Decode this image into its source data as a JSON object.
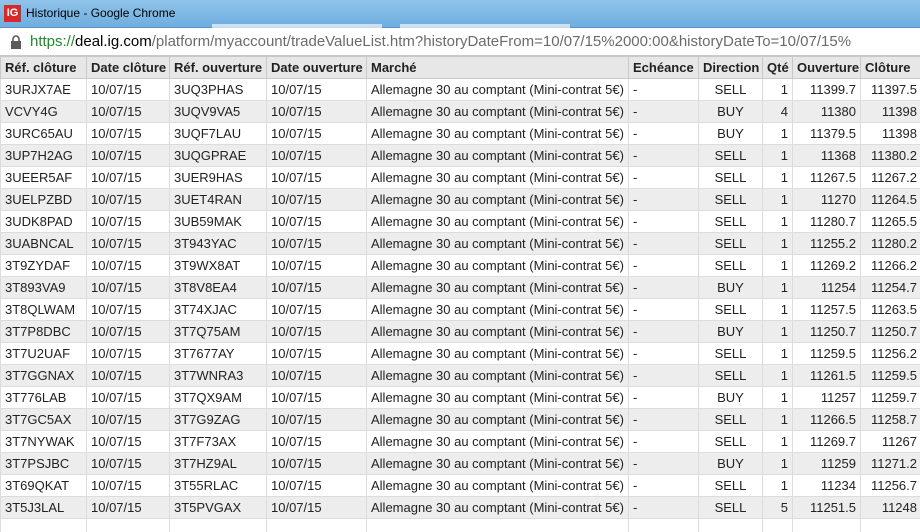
{
  "window": {
    "logo_text": "IG",
    "title": "Historique - Google Chrome"
  },
  "address": {
    "scheme": "https://",
    "host": "deal.ig.com",
    "path": "/platform/myaccount/tradeValueList.htm?historyDateFrom=10/07/15%2000:00&historyDateTo=10/07/15%"
  },
  "table": {
    "headers": [
      "Réf. clôture",
      "Date clôture",
      "Réf. ouverture",
      "Date ouverture",
      "Marché",
      "Echéance",
      "Direction",
      "Qté",
      "Ouverture",
      "Clôture"
    ],
    "rows": [
      [
        "3URJX7AE",
        "10/07/15",
        "3UQ3PHAS",
        "10/07/15",
        "Allemagne 30 au comptant (Mini-contrat 5€)",
        "-",
        "SELL",
        "1",
        "11399.7",
        "11397.5"
      ],
      [
        "VCVY4G",
        "10/07/15",
        "3UQV9VA5",
        "10/07/15",
        "Allemagne 30 au comptant (Mini-contrat 5€)",
        "-",
        "BUY",
        "4",
        "11380",
        "11398"
      ],
      [
        "3URC65AU",
        "10/07/15",
        "3UQF7LAU",
        "10/07/15",
        "Allemagne 30 au comptant (Mini-contrat 5€)",
        "-",
        "BUY",
        "1",
        "11379.5",
        "11398"
      ],
      [
        "3UP7H2AG",
        "10/07/15",
        "3UQGPRAE",
        "10/07/15",
        "Allemagne 30 au comptant (Mini-contrat 5€)",
        "-",
        "SELL",
        "1",
        "11368",
        "11380.2"
      ],
      [
        "3UEER5AF",
        "10/07/15",
        "3UER9HAS",
        "10/07/15",
        "Allemagne 30 au comptant (Mini-contrat 5€)",
        "-",
        "SELL",
        "1",
        "11267.5",
        "11267.2"
      ],
      [
        "3UELPZBD",
        "10/07/15",
        "3UET4RAN",
        "10/07/15",
        "Allemagne 30 au comptant (Mini-contrat 5€)",
        "-",
        "SELL",
        "1",
        "11270",
        "11264.5"
      ],
      [
        "3UDK8PAD",
        "10/07/15",
        "3UB59MAK",
        "10/07/15",
        "Allemagne 30 au comptant (Mini-contrat 5€)",
        "-",
        "SELL",
        "1",
        "11280.7",
        "11265.5"
      ],
      [
        "3UABNCAL",
        "10/07/15",
        "3T943YAC",
        "10/07/15",
        "Allemagne 30 au comptant (Mini-contrat 5€)",
        "-",
        "SELL",
        "1",
        "11255.2",
        "11280.2"
      ],
      [
        "3T9ZYDAF",
        "10/07/15",
        "3T9WX8AT",
        "10/07/15",
        "Allemagne 30 au comptant (Mini-contrat 5€)",
        "-",
        "SELL",
        "1",
        "11269.2",
        "11266.2"
      ],
      [
        "3T893VA9",
        "10/07/15",
        "3T8V8EA4",
        "10/07/15",
        "Allemagne 30 au comptant (Mini-contrat 5€)",
        "-",
        "BUY",
        "1",
        "11254",
        "11254.7"
      ],
      [
        "3T8QLWAM",
        "10/07/15",
        "3T74XJAC",
        "10/07/15",
        "Allemagne 30 au comptant (Mini-contrat 5€)",
        "-",
        "SELL",
        "1",
        "11257.5",
        "11263.5"
      ],
      [
        "3T7P8DBC",
        "10/07/15",
        "3T7Q75AM",
        "10/07/15",
        "Allemagne 30 au comptant (Mini-contrat 5€)",
        "-",
        "BUY",
        "1",
        "11250.7",
        "11250.7"
      ],
      [
        "3T7U2UAF",
        "10/07/15",
        "3T7677AY",
        "10/07/15",
        "Allemagne 30 au comptant (Mini-contrat 5€)",
        "-",
        "SELL",
        "1",
        "11259.5",
        "11256.2"
      ],
      [
        "3T7GGNAX",
        "10/07/15",
        "3T7WNRA3",
        "10/07/15",
        "Allemagne 30 au comptant (Mini-contrat 5€)",
        "-",
        "SELL",
        "1",
        "11261.5",
        "11259.5"
      ],
      [
        "3T776LAB",
        "10/07/15",
        "3T7QX9AM",
        "10/07/15",
        "Allemagne 30 au comptant (Mini-contrat 5€)",
        "-",
        "BUY",
        "1",
        "11257",
        "11259.7"
      ],
      [
        "3T7GC5AX",
        "10/07/15",
        "3T7G9ZAG",
        "10/07/15",
        "Allemagne 30 au comptant (Mini-contrat 5€)",
        "-",
        "SELL",
        "1",
        "11266.5",
        "11258.7"
      ],
      [
        "3T7NYWAK",
        "10/07/15",
        "3T7F73AX",
        "10/07/15",
        "Allemagne 30 au comptant (Mini-contrat 5€)",
        "-",
        "SELL",
        "1",
        "11269.7",
        "11267"
      ],
      [
        "3T7PSJBC",
        "10/07/15",
        "3T7HZ9AL",
        "10/07/15",
        "Allemagne 30 au comptant (Mini-contrat 5€)",
        "-",
        "BUY",
        "1",
        "11259",
        "11271.2"
      ],
      [
        "3T69QKAT",
        "10/07/15",
        "3T55RLAC",
        "10/07/15",
        "Allemagne 30 au comptant (Mini-contrat 5€)",
        "-",
        "SELL",
        "1",
        "11234",
        "11256.7"
      ],
      [
        "3T5J3LAL",
        "10/07/15",
        "3T5PVGAX",
        "10/07/15",
        "Allemagne 30 au comptant (Mini-contrat 5€)",
        "-",
        "SELL",
        "5",
        "11251.5",
        "11248"
      ],
      [
        "",
        "",
        "",
        "",
        "",
        "",
        "",
        "",
        "",
        ""
      ]
    ]
  }
}
